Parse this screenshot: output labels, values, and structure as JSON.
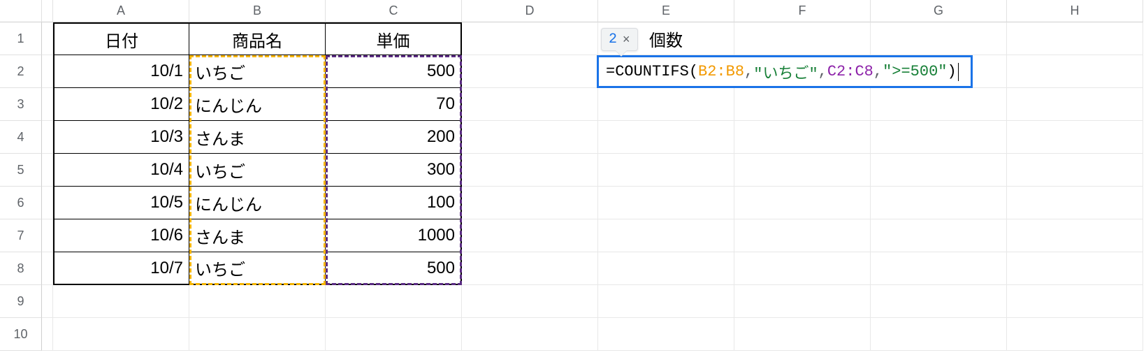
{
  "columns": [
    "A",
    "B",
    "C",
    "D",
    "E",
    "F",
    "G",
    "H"
  ],
  "rows": [
    "1",
    "2",
    "3",
    "4",
    "5",
    "6",
    "7",
    "8",
    "9",
    "10"
  ],
  "header": {
    "A": "日付",
    "B": "商品名",
    "C": "単価",
    "E": "個数"
  },
  "data": {
    "2": {
      "A": "10/1",
      "B": "いちご",
      "C": "500"
    },
    "3": {
      "A": "10/2",
      "B": "にんじん",
      "C": "70"
    },
    "4": {
      "A": "10/3",
      "B": "さんま",
      "C": "200"
    },
    "5": {
      "A": "10/4",
      "B": "いちご",
      "C": "300"
    },
    "6": {
      "A": "10/5",
      "B": "にんじん",
      "C": "100"
    },
    "7": {
      "A": "10/6",
      "B": "さんま",
      "C": "1000"
    },
    "8": {
      "A": "10/7",
      "B": "いちご",
      "C": "500"
    }
  },
  "formula": {
    "eq": "=",
    "fn": "COUNTIFS",
    "open": "(",
    "r1": "B2:B8",
    "c1": ",",
    "s1": "\"いちご\"",
    "c2": ",",
    "r2": "C2:C8",
    "c3": ",",
    "s2": "\">=500\"",
    "close": ")"
  },
  "hint": {
    "value": "2",
    "close": "×"
  }
}
